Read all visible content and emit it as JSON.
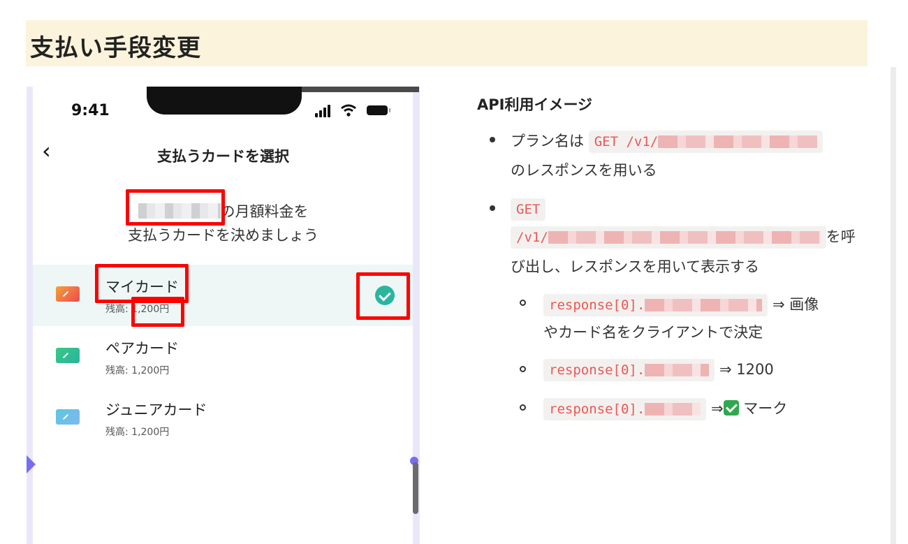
{
  "page": {
    "title": "支払い手段変更"
  },
  "phone": {
    "status_time": "9:41",
    "nav_title": "支払うカードを選択",
    "lead_line1_suffix": "の月額料金を",
    "lead_line2": "支払うカードを決めましょう",
    "cards": [
      {
        "name": "マイカード",
        "balance": "残高: 1,200円",
        "selected": true,
        "icon_color": "#f06a3a"
      },
      {
        "name": "ペアカード",
        "balance": "残高: 1,200円",
        "selected": false,
        "icon_color": "#3ec77f"
      },
      {
        "name": "ジュニアカード",
        "balance": "残高: 1,200円",
        "selected": false,
        "icon_color": "#56c2dc"
      }
    ]
  },
  "doc": {
    "heading": "API利用イメージ",
    "bullet1": {
      "prefix": "プラン名は",
      "code": "GET /v1/",
      "line2": "のレスポンスを用いる"
    },
    "bullet2": {
      "code1": "GET",
      "code2": "/v1/",
      "suffix": "を呼",
      "line3": "び出し、レスポンスを用いて表示する"
    },
    "sub_items": [
      {
        "code": "response[0].",
        "suffix": "⇒ 画像",
        "line2": "やカード名をクライアントで決定"
      },
      {
        "code": "response[0].",
        "suffix": "⇒ 1200"
      },
      {
        "code": "response[0].",
        "suffix": "マーク",
        "arrow": "⇒"
      }
    ]
  },
  "colors": {
    "accent_red": "#ff0000",
    "check_teal": "#2bb5a0",
    "title_bg": "#fbf3db",
    "code_red": "#eb5757"
  }
}
